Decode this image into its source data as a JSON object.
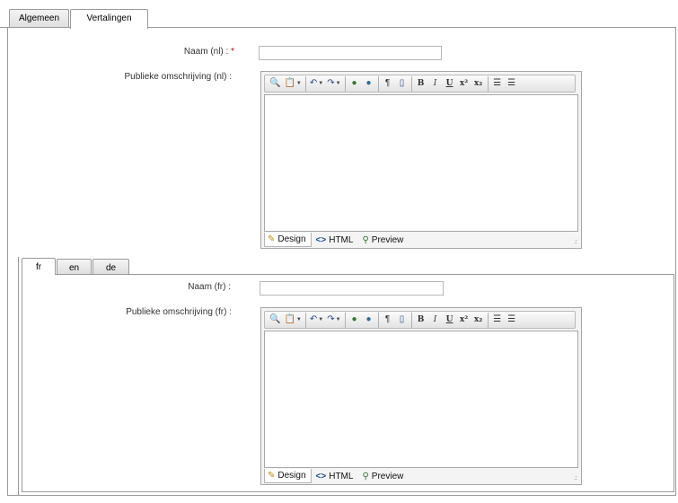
{
  "top_tabs": [
    {
      "label": "Algemeen",
      "active": false
    },
    {
      "label": "Vertalingen",
      "active": true
    }
  ],
  "nl": {
    "name_label": "Naam (nl) :",
    "required_mark": "*",
    "name_value": "",
    "description_label": "Publieke omschrijving (nl) :"
  },
  "lang_tabs": [
    {
      "label": "fr",
      "active": true
    },
    {
      "label": "en",
      "active": false
    },
    {
      "label": "de",
      "active": false
    }
  ],
  "fr": {
    "name_label": "Naam (fr) :",
    "name_value": "",
    "description_label": "Publieke omschrijving (fr) :"
  },
  "editor": {
    "toolbar_icons": [
      "find-icon",
      "paste-icon",
      "undo-icon",
      "redo-icon",
      "link-icon",
      "unlink-icon",
      "paragraph-icon",
      "insert-icon",
      "bold-icon",
      "italic-icon",
      "underline-icon",
      "superscript-icon",
      "subscript-icon",
      "ordered-list-icon",
      "unordered-list-icon"
    ],
    "bold": "B",
    "italic": "I",
    "underline": "U",
    "superscript": "x²",
    "subscript": "x₂",
    "modes": {
      "design": "Design",
      "html": "HTML",
      "preview": "Preview"
    }
  }
}
